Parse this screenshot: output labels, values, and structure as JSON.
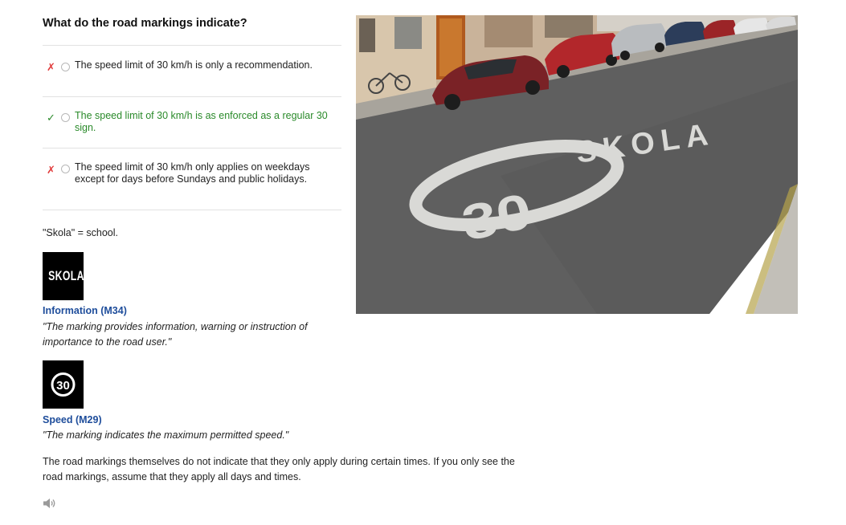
{
  "question": "What do the road markings indicate?",
  "answers": [
    {
      "mark": "✗",
      "text": "The speed limit of 30 km/h is only a recommendation."
    },
    {
      "mark": "✓",
      "text": "The speed limit of 30 km/h is as enforced as a regular 30 sign."
    },
    {
      "mark": "✗",
      "text": "The speed limit of 30 km/h only applies on weekdays except for days before Sundays and public holidays."
    }
  ],
  "note": "\"Skola\" = school.",
  "signs": [
    {
      "glyph": "SKOLA",
      "title": "Information (M34)",
      "description": "\"The marking provides information, warning or instruction of importance to the road user.\""
    },
    {
      "glyph": "30",
      "title": "Speed (M29)",
      "description": "\"The marking indicates the maximum permitted speed.\""
    }
  ],
  "explanation": "The road markings themselves do not indicate that they only apply during certain times. If you only see the road markings, assume that they apply all days and times.",
  "photo": {
    "road_text": "SKOLA",
    "road_number": "30"
  },
  "icons": {
    "audio": "speaker-icon"
  },
  "colors": {
    "correct": "#2a8a2a",
    "wrong": "#e13b3b",
    "sign_title": "#1e4d9b"
  }
}
